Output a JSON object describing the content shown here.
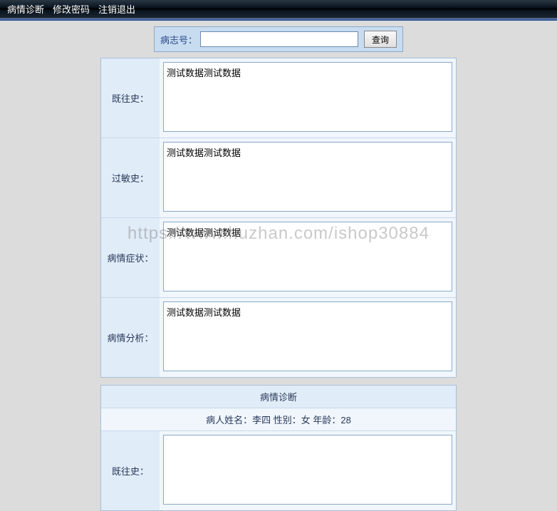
{
  "nav": {
    "item1": "病情诊断",
    "item2": "修改密码",
    "item3": "注销退出"
  },
  "search": {
    "label": "病志号：",
    "value": "",
    "button": "查询"
  },
  "fields": {
    "history": {
      "label": "既往史：",
      "value": "测试数据测试数据"
    },
    "allergy": {
      "label": "过敏史：",
      "value": "测试数据测试数据"
    },
    "symptom": {
      "label": "病情症状：",
      "value": "测试数据测试数据"
    },
    "analysis": {
      "label": "病情分析：",
      "value": "测试数据测试数据"
    }
  },
  "diagnosis": {
    "title": "病情诊断",
    "patient_label_name": "病人姓名：",
    "patient_name": "李四",
    "patient_label_gender": " 性别：",
    "patient_gender": "女",
    "patient_label_age": " 年龄：",
    "patient_age": "28",
    "history_label": "既往史：",
    "history_value": ""
  },
  "watermark": "https://www.huzhan.com/ishop30884"
}
